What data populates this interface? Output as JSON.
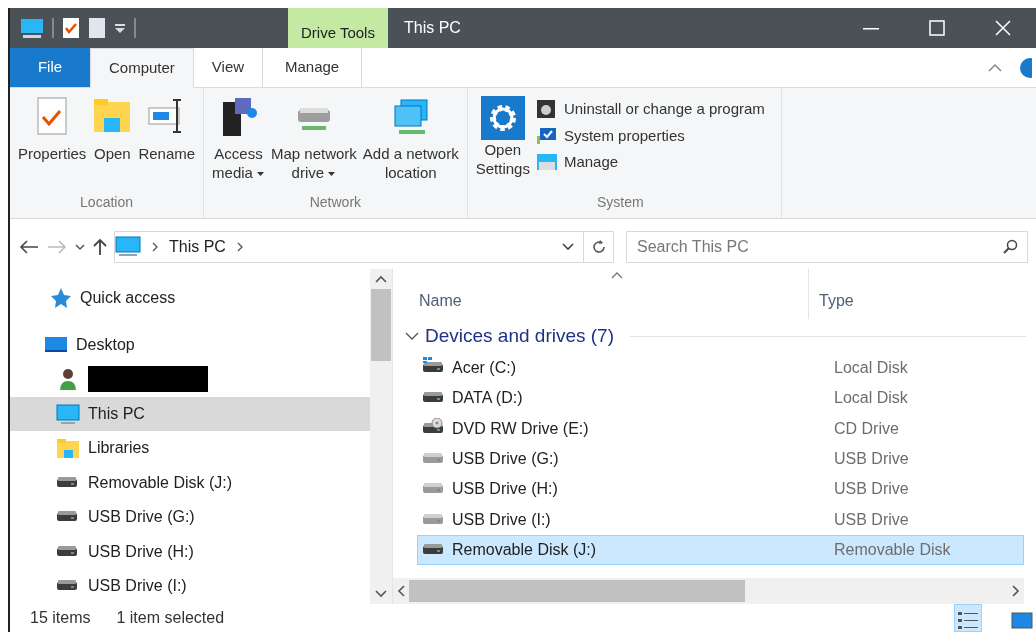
{
  "window": {
    "title": "This PC",
    "context_tab": "Drive Tools"
  },
  "ribbon_tabs": [
    {
      "label": "File",
      "kind": "file",
      "selected": false
    },
    {
      "label": "Computer",
      "kind": "tab",
      "selected": true
    },
    {
      "label": "View",
      "kind": "tab",
      "selected": false
    },
    {
      "label": "Manage",
      "kind": "context",
      "selected": false
    }
  ],
  "ribbon_groups": [
    {
      "label": "Location",
      "buttons": [
        {
          "label": "Properties",
          "kind": "large"
        },
        {
          "label": "Open",
          "kind": "large"
        },
        {
          "label": "Rename",
          "kind": "large"
        }
      ]
    },
    {
      "label": "Network",
      "buttons": [
        {
          "label": "Access\nmedia",
          "kind": "large",
          "dropdown": true
        },
        {
          "label": "Map network\ndrive",
          "kind": "large",
          "dropdown": true
        },
        {
          "label": "Add a network\nlocation",
          "kind": "large",
          "dropdown": false
        }
      ]
    },
    {
      "label": "System",
      "buttons": [
        {
          "label": "Open\nSettings",
          "kind": "large"
        },
        {
          "label": "Uninstall or change a program",
          "kind": "small"
        },
        {
          "label": "System properties",
          "kind": "small"
        },
        {
          "label": "Manage",
          "kind": "small"
        }
      ]
    }
  ],
  "address_bar": {
    "crumbs": [
      "This PC"
    ]
  },
  "search": {
    "placeholder": "Search This PC"
  },
  "navigation": [
    {
      "label": "Quick access",
      "kind": "star",
      "selected": false
    },
    {
      "label": "Desktop",
      "kind": "desktop",
      "selected": false,
      "children": [
        {
          "kind": "user",
          "redacted": true,
          "selected": false
        },
        {
          "label": "This PC",
          "kind": "pc",
          "selected": true
        },
        {
          "label": "Libraries",
          "kind": "library",
          "selected": false
        },
        {
          "label": "Removable Disk (J:)",
          "kind": "drive",
          "selected": false
        },
        {
          "label": "USB Drive (G:)",
          "kind": "drive",
          "selected": false
        },
        {
          "label": "USB Drive (H:)",
          "kind": "drive",
          "selected": false
        },
        {
          "label": "USB Drive (I:)",
          "kind": "drive",
          "selected": false
        }
      ]
    }
  ],
  "columns": [
    {
      "label": "Name",
      "sorted": true
    },
    {
      "label": "Type",
      "sorted": false
    }
  ],
  "group": {
    "label": "Devices and drives (7)",
    "expanded": true
  },
  "rows": [
    {
      "name": "Acer (C:)",
      "type": "Local Disk",
      "kind": "system",
      "selected": false
    },
    {
      "name": "DATA (D:)",
      "type": "Local Disk",
      "kind": "disk",
      "selected": false
    },
    {
      "name": "DVD RW Drive (E:)",
      "type": "CD Drive",
      "kind": "dvd",
      "selected": false
    },
    {
      "name": "USB Drive (G:)",
      "type": "USB Drive",
      "kind": "usb",
      "selected": false
    },
    {
      "name": "USB Drive (H:)",
      "type": "USB Drive",
      "kind": "usb",
      "selected": false
    },
    {
      "name": "USB Drive (I:)",
      "type": "USB Drive",
      "kind": "usb",
      "selected": false
    },
    {
      "name": "Removable Disk (J:)",
      "type": "Removable Disk",
      "kind": "disk",
      "selected": true
    }
  ],
  "status_bar": {
    "items": "15 items",
    "selection": "1 item selected"
  },
  "view_buttons": [
    {
      "kind": "details",
      "selected": true
    },
    {
      "kind": "tiles",
      "selected": false
    }
  ]
}
